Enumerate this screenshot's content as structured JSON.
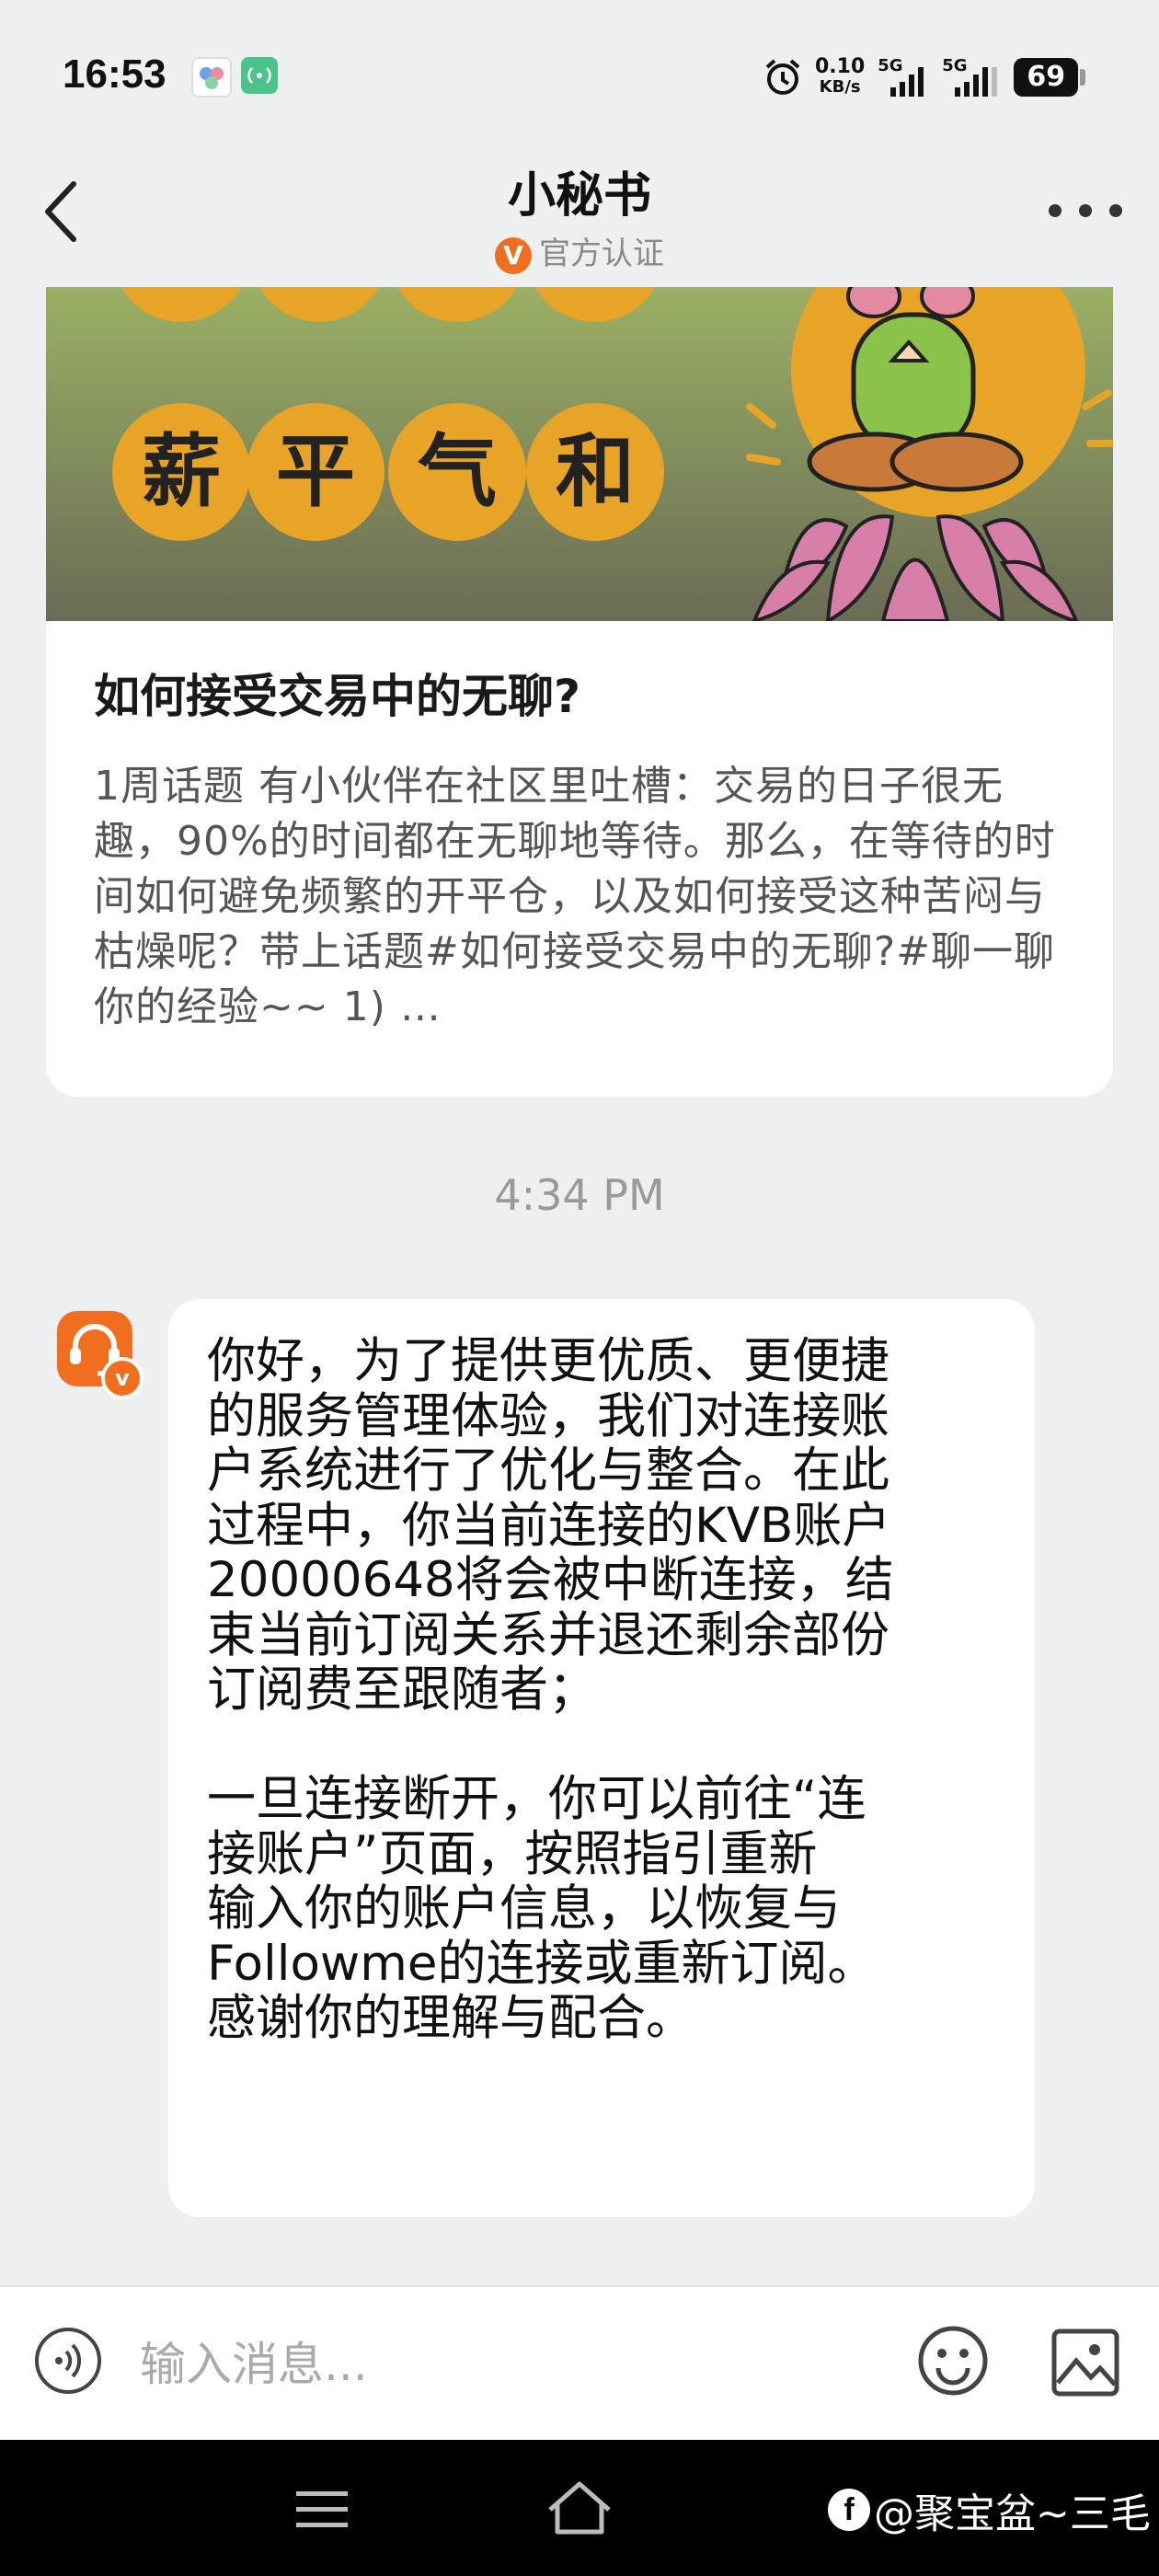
{
  "status_bar": {
    "time": "16:53",
    "net_speed": "0.10",
    "net_unit": "KB/s",
    "sim1": "5G",
    "sim2": "5G",
    "battery": "69"
  },
  "header": {
    "title": "小秘书",
    "badge_letter": "V",
    "subtitle": "官方认证"
  },
  "article_card": {
    "banner_chars_top": [
      "",
      "",
      "",
      ""
    ],
    "banner_chars": [
      "薪",
      "平",
      "气",
      "和"
    ],
    "title": "如何接受交易中的无聊?",
    "body": "1周话题 有小伙伴在社区里吐槽：交易的日子很无趣，90%的时间都在无聊地等待。那么，在等待的时间如何避免频繁的开平仓，以及如何接受这种苦闷与枯燥呢？带上话题#如何接受交易中的无聊?#聊一聊你的经验~~ 1) …"
  },
  "timestamp": "4:34 PM",
  "message": {
    "avatar_badge": "v",
    "paragraph1_lines": [
      "你好，为了提供更优质、更便捷",
      "的服务管理体验，我们对连接账",
      "户系统进行了优化与整合。在此",
      "过程中，你当前连接的KVB账户",
      "20000648将会被中断连接，结",
      "束当前订阅关系并退还剩余部份",
      "订阅费至跟随者；"
    ],
    "paragraph2_lines": [
      "一旦连接断开，你可以前往“连",
      "接账户”页面，按照指引重新",
      "输入你的账户信息，以恢复与",
      "Followme的连接或重新订阅。",
      "感谢你的理解与配合。"
    ]
  },
  "input_bar": {
    "placeholder": "输入消息..."
  },
  "watermark": {
    "fb_letter": "f",
    "text": "@聚宝盆~三毛"
  },
  "colors": {
    "accent": "#f06e1e",
    "banner_circle": "#e8a426",
    "background": "#eeeff1"
  }
}
